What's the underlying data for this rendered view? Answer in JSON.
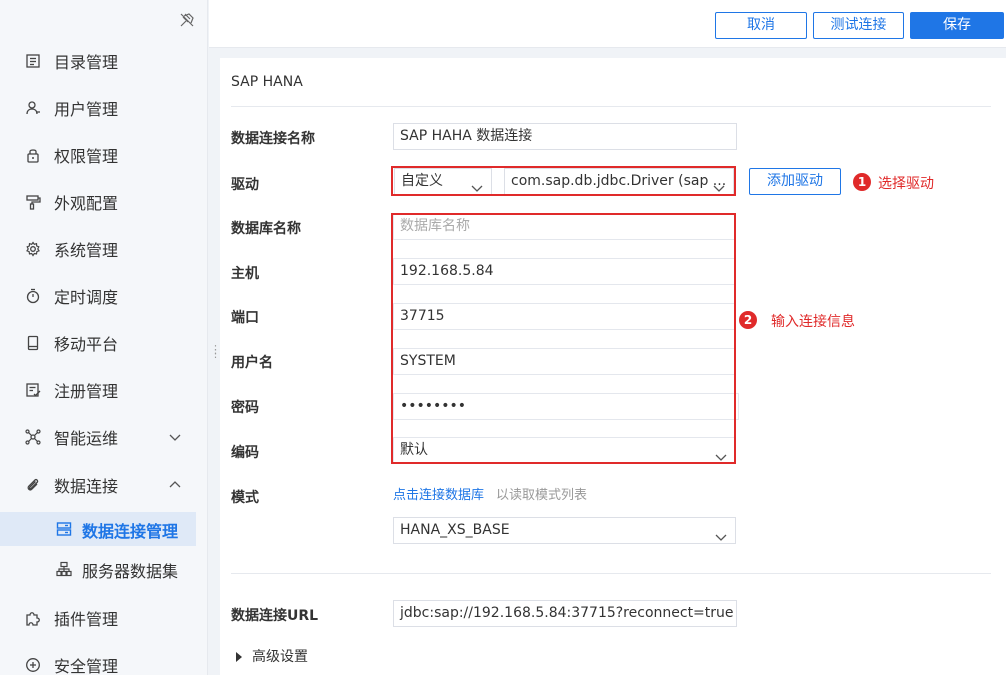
{
  "sidebar": {
    "items": [
      {
        "label": "目录管理",
        "icon": "catalog-icon"
      },
      {
        "label": "用户管理",
        "icon": "user-icon"
      },
      {
        "label": "权限管理",
        "icon": "lock-icon"
      },
      {
        "label": "外观配置",
        "icon": "paint-roller-icon"
      },
      {
        "label": "系统管理",
        "icon": "gear-icon"
      },
      {
        "label": "定时调度",
        "icon": "stopwatch-icon"
      },
      {
        "label": "移动平台",
        "icon": "mobile-icon"
      },
      {
        "label": "注册管理",
        "icon": "register-icon"
      },
      {
        "label": "智能运维",
        "icon": "network-icon"
      },
      {
        "label": "数据连接",
        "icon": "paperclip-icon"
      },
      {
        "label": "插件管理",
        "icon": "puzzle-icon"
      },
      {
        "label": "安全管理",
        "icon": "shield-icon"
      }
    ],
    "sub_items": [
      {
        "label": "数据连接管理",
        "icon": "server-icon"
      },
      {
        "label": "服务器数据集",
        "icon": "dataset-icon"
      }
    ]
  },
  "toolbar": {
    "cancel_label": "取消",
    "test_label": "测试连接",
    "save_label": "保存"
  },
  "form": {
    "section_title": "SAP HANA",
    "connection_name_label": "数据连接名称",
    "connection_name_value": "SAP HAHA 数据连接",
    "driver_label": "驱动",
    "driver_type_value": "自定义",
    "driver_class_value": "com.sap.db.jdbc.Driver (sap ...",
    "add_driver_label": "添加驱动",
    "database_name_label": "数据库名称",
    "database_name_placeholder": "数据库名称",
    "host_label": "主机",
    "host_value": "192.168.5.84",
    "port_label": "端口",
    "port_value": "37715",
    "username_label": "用户名",
    "username_value": "SYSTEM",
    "password_label": "密码",
    "password_value": "••••••••",
    "encoding_label": "编码",
    "encoding_value": "默认",
    "schema_label": "模式",
    "schema_link": "点击连接数据库",
    "schema_hint": "以读取模式列表",
    "schema_value": "HANA_XS_BASE",
    "url_label": "数据连接URL",
    "url_value": "jdbc:sap://192.168.5.84:37715?reconnect=true",
    "advanced_label": "高级设置"
  },
  "annotations": {
    "step1_number": "1",
    "step1_text": "选择驱动",
    "step2_number": "2",
    "step2_text": "输入连接信息"
  },
  "colors": {
    "accent": "#1f76e6",
    "annotation_red": "#e02a2a",
    "active_bg": "#dfe9f7"
  }
}
